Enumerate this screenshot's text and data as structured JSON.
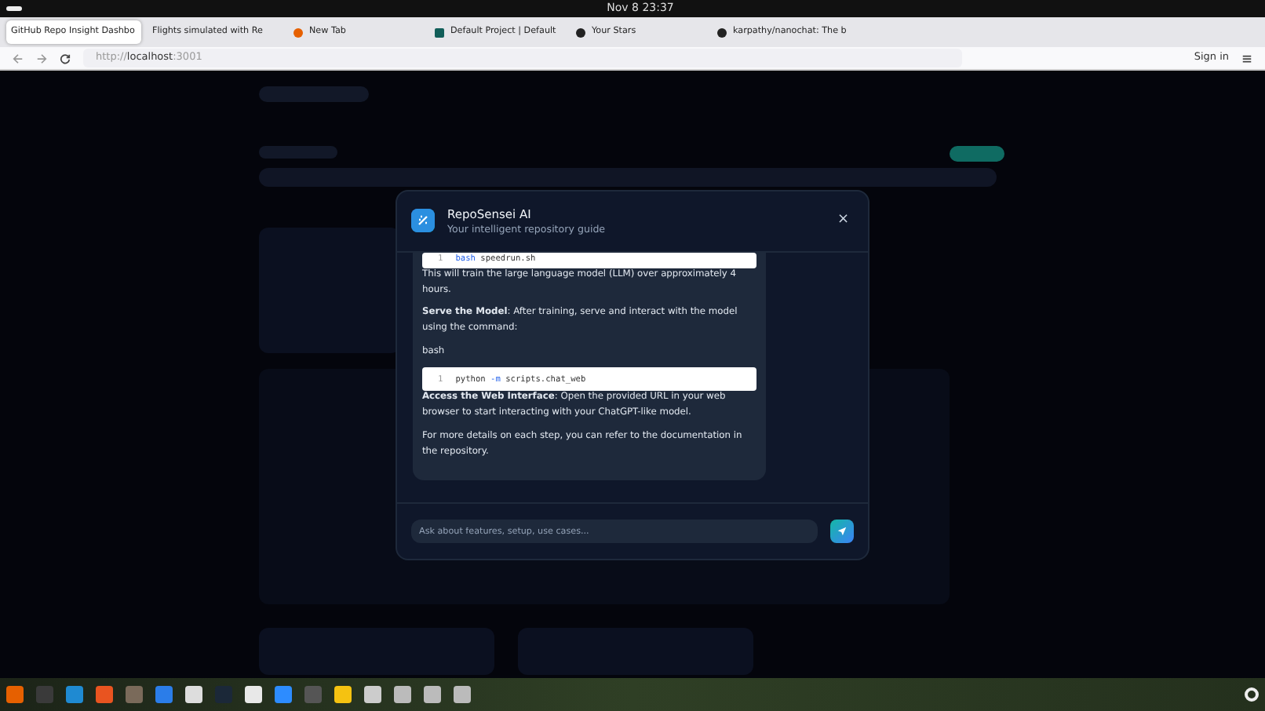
{
  "system_bar": {
    "clock": "Nov 8  23:37"
  },
  "tabs": [
    {
      "label": "GitHub Repo Insight Dashbo",
      "selected": true
    },
    {
      "label": "Flights simulated with Re",
      "selected": false
    },
    {
      "label": "New Tab",
      "selected": false
    },
    {
      "label": "Default Project | Default",
      "selected": false
    },
    {
      "label": "Your Stars",
      "selected": false
    },
    {
      "label": "karpathy/nanochat: The b",
      "selected": false
    }
  ],
  "address_bar": {
    "url_prefix": "http://",
    "url_host": "localhost",
    "url_port": ":3001",
    "sign_in": "Sign in"
  },
  "modal": {
    "title": "RepoSensei AI",
    "subtitle": "Your intelligent repository guide",
    "close": "×",
    "message": [
      {
        "kind": "code",
        "line_no": "1",
        "code": "**bash** speedrun.sh"
      },
      {
        "kind": "text",
        "text": "This will train the large language model (LLM) over approximately 4 hours."
      },
      {
        "kind": "text",
        "text": "**Serve the Model**: After training, serve and interact with the model using the command:"
      },
      {
        "kind": "text",
        "text": "bash"
      },
      {
        "kind": "code",
        "line_no": "1",
        "code": "python **-m** scripts.chat_web"
      },
      {
        "kind": "text",
        "text": "**Access the Web Interface**: Open the provided URL in your web browser to start interacting with your ChatGPT-like model."
      },
      {
        "kind": "text",
        "text": "For more details on each step, you can refer to the documentation in the repository."
      }
    ],
    "input": {
      "placeholder": "Ask about features, setup, use cases..."
    }
  },
  "dock": [
    {
      "color": "#e66000"
    },
    {
      "color": "#3a3a3a"
    },
    {
      "color": "#1f8ad2"
    },
    {
      "color": "#e95420"
    },
    {
      "color": "#7a6a5a"
    },
    {
      "color": "#2b7de9"
    },
    {
      "color": "#dddddd"
    },
    {
      "color": "#1b2838"
    },
    {
      "color": "#e8e8e8"
    },
    {
      "color": "#2d8cff"
    },
    {
      "color": "#555555"
    },
    {
      "color": "#f5c211"
    },
    {
      "color": "#cccccc"
    },
    {
      "color": "#bbbbbb"
    },
    {
      "color": "#bbbbbb"
    },
    {
      "color": "#bbbbbb"
    }
  ]
}
